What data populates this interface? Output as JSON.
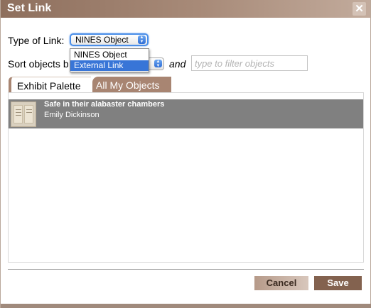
{
  "dialog": {
    "title": "Set Link",
    "close_glyph": "✕"
  },
  "type_of_link": {
    "label": "Type of Link:",
    "selected": "NINES Object",
    "options": [
      {
        "label": "NINES Object",
        "highlighted": false
      },
      {
        "label": "External Link",
        "highlighted": true
      }
    ]
  },
  "sort": {
    "label": "Sort objects b",
    "and_text": "and",
    "filter_placeholder": "type to filter objects"
  },
  "tabs": [
    {
      "label": "Exhibit Palette",
      "active": true
    },
    {
      "label": "All My Objects",
      "active": false
    }
  ],
  "objects": [
    {
      "title": "Safe in their alabaster chambers",
      "author": "Emily Dickinson",
      "thumbnail": "manuscript-thumbnail"
    }
  ],
  "buttons": {
    "cancel": "Cancel",
    "save": "Save"
  },
  "colors": {
    "accent_brown": "#a88572",
    "save_brown": "#83624f",
    "selected_row": "#808080",
    "dropdown_highlight": "#3875d7",
    "focus_blue": "#4a8ee8"
  },
  "icons": {
    "close": "close-icon",
    "select_arrows": "updown-arrows-icon"
  }
}
